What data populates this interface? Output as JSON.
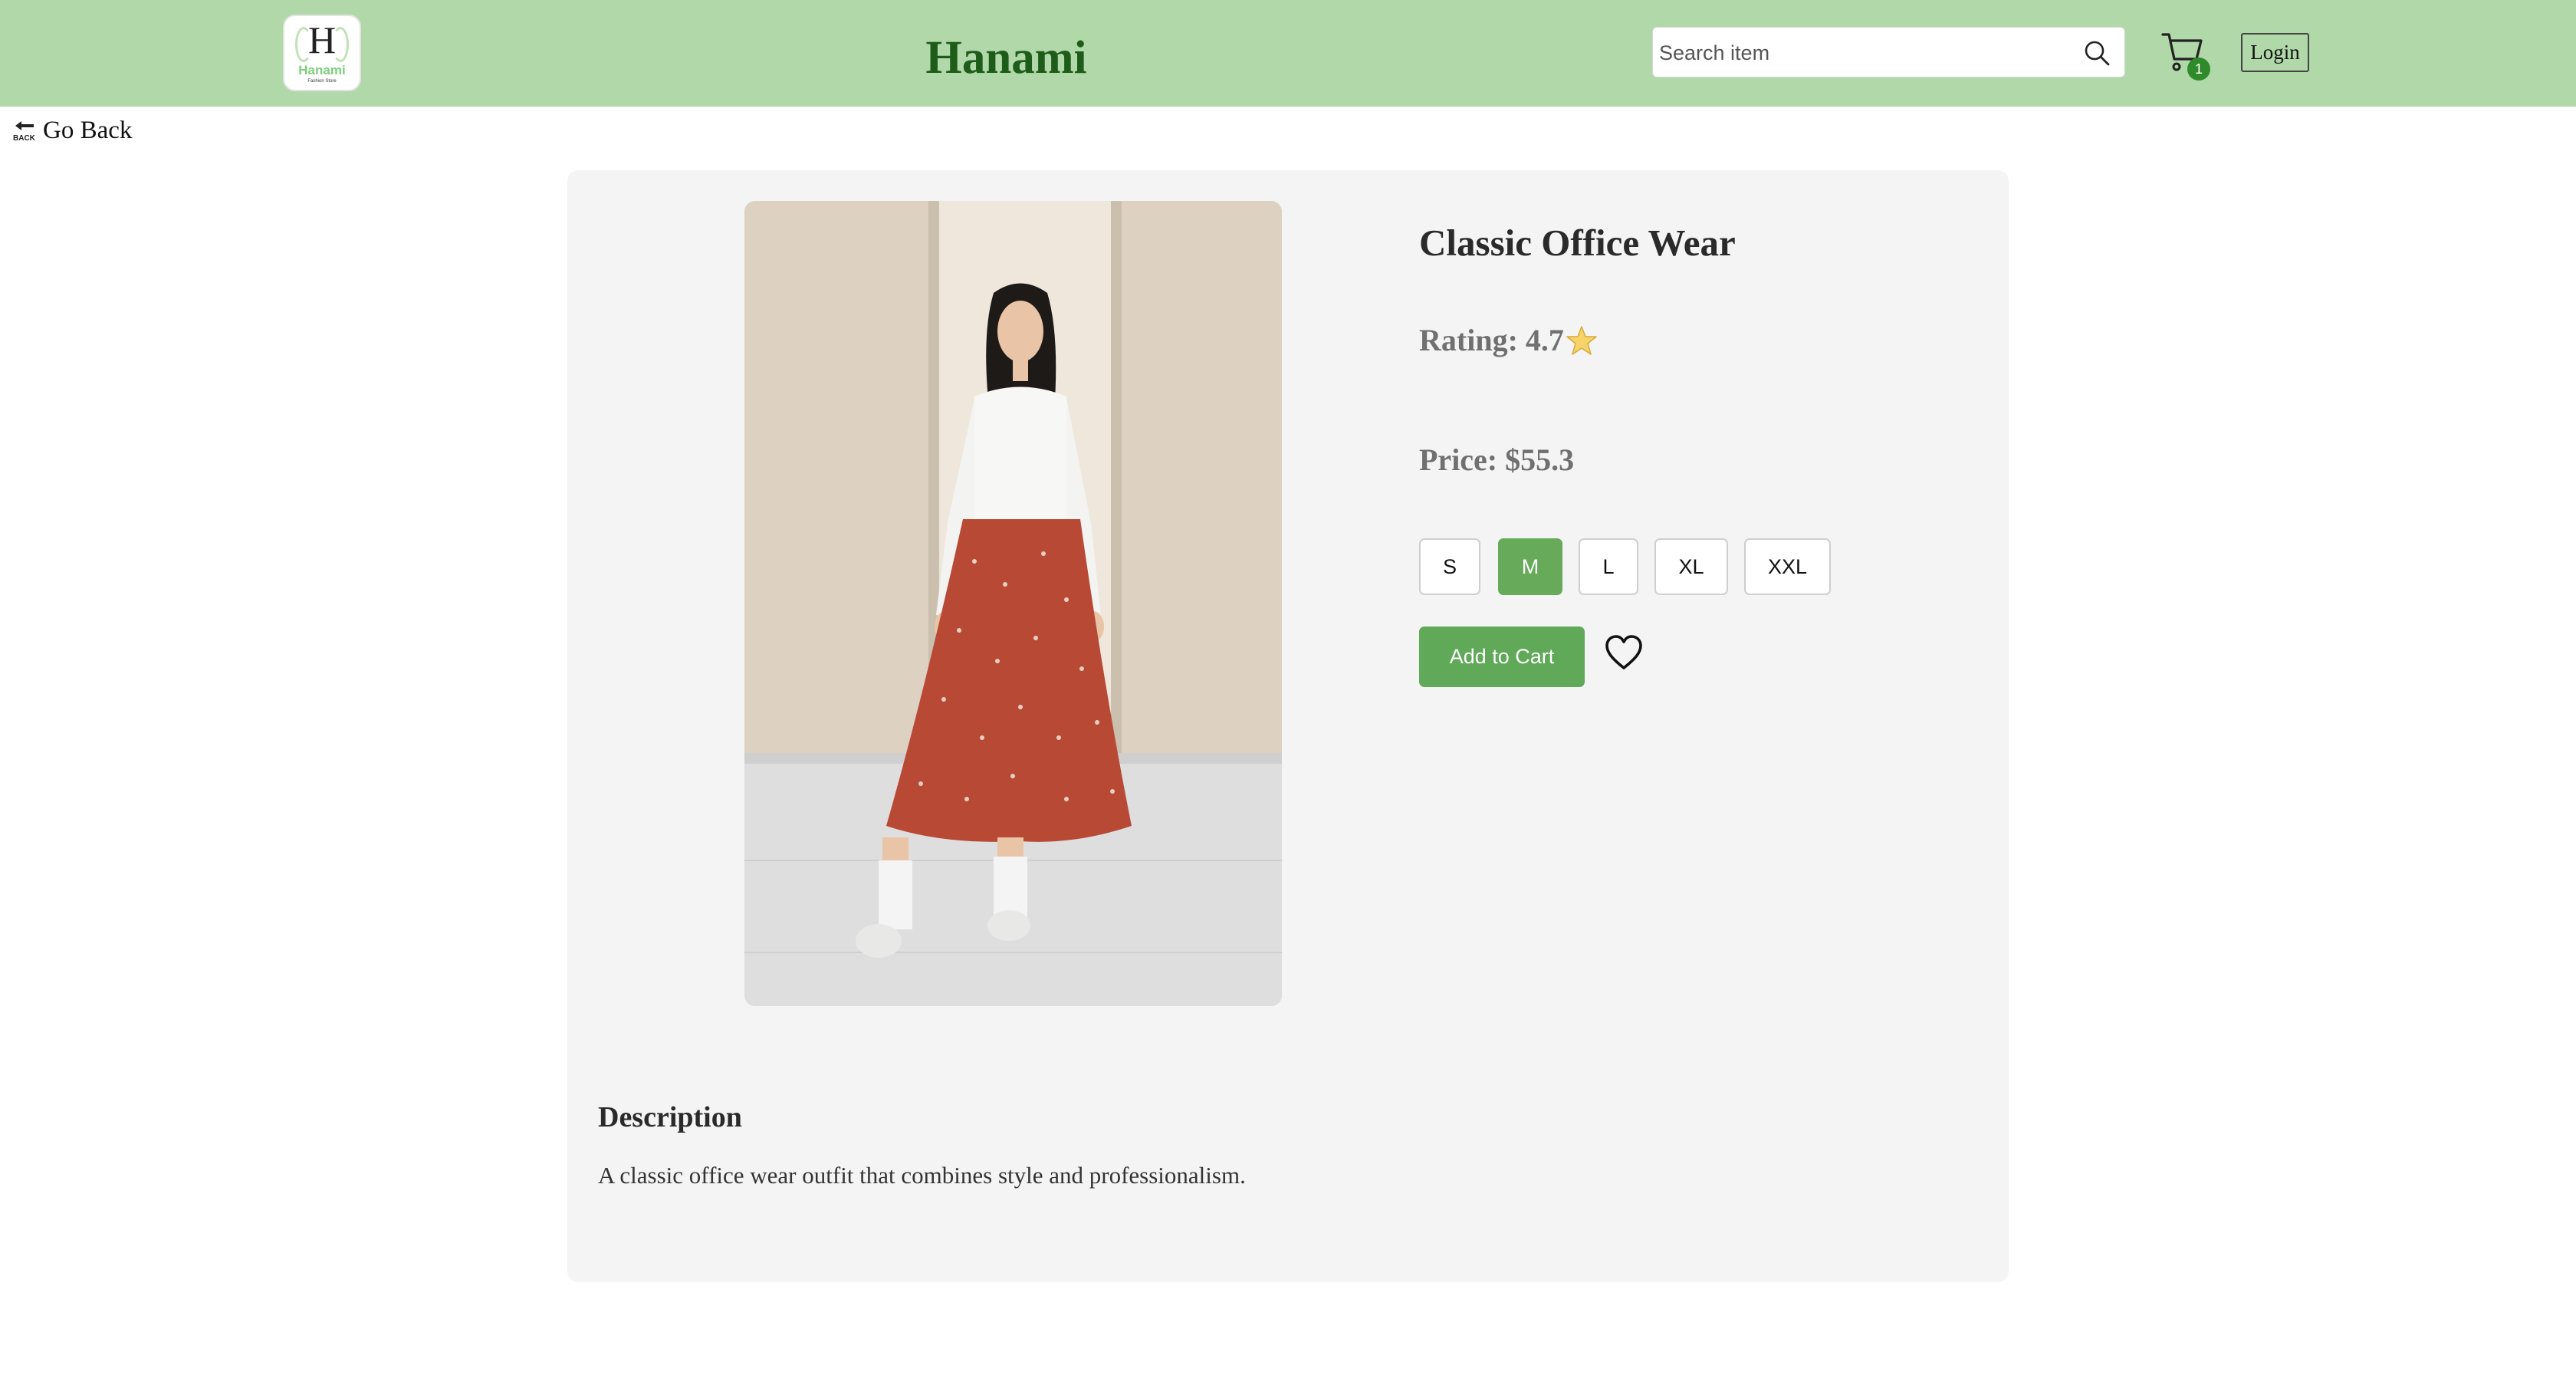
{
  "header": {
    "logo": {
      "letter": "H",
      "word": "Hanami",
      "tagline": "Fashion Store"
    },
    "brand": "Hanami",
    "search": {
      "placeholder": "Search item",
      "value": ""
    },
    "cart": {
      "count": "1"
    },
    "login_label": "Login"
  },
  "nav": {
    "back_label": "Go Back",
    "back_icon_text": "BACK"
  },
  "product": {
    "title": "Classic Office Wear",
    "rating_label": "Rating: 4.7",
    "price_label": "Price: $55.3",
    "sizes": [
      "S",
      "M",
      "L",
      "XL",
      "XXL"
    ],
    "selected_size": "M",
    "add_to_cart_label": "Add to Cart",
    "description_heading": "Description",
    "description": "A classic office wear outfit that combines style and professionalism."
  },
  "icons": {
    "search": "search-icon",
    "cart": "cart-icon",
    "back": "back-arrow-icon",
    "rating": "star-icon",
    "wishlist": "heart-icon"
  },
  "colors": {
    "header_bg": "#b0d8a8",
    "brand_text": "#1e5c1a",
    "accent": "#5fa958",
    "badge": "#2f8a2a",
    "card_bg": "#f4f4f4"
  }
}
